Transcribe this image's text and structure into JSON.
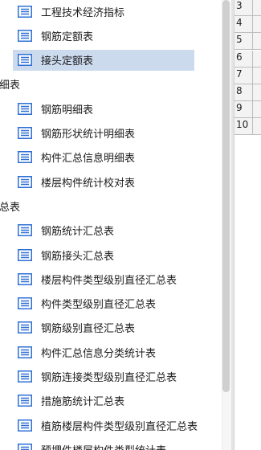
{
  "tree": {
    "items": [
      {
        "type": "item",
        "label": "工程技术经济指标",
        "name": "tree-item-gongcheng-jishu-jingji-zhibiao"
      },
      {
        "type": "item",
        "label": "钢筋定额表",
        "name": "tree-item-gangjin-ding-e-biao"
      },
      {
        "type": "item",
        "label": "接头定额表",
        "name": "tree-item-jietou-ding-e-biao",
        "selected": true
      },
      {
        "type": "group",
        "label": "明细表",
        "name": "tree-group-mingxibiao"
      },
      {
        "type": "item",
        "label": "钢筋明细表",
        "name": "tree-item-gangjin-mingxibiao"
      },
      {
        "type": "item",
        "label": "钢筋形状统计明细表",
        "name": "tree-item-gangjin-xingzhuang-tongji-mingxibiao"
      },
      {
        "type": "item",
        "label": "构件汇总信息明细表",
        "name": "tree-item-goujian-huizong-xinxi-mingxibiao"
      },
      {
        "type": "item",
        "label": "楼层构件统计校对表",
        "name": "tree-item-louceng-goujian-tongji-jiaodui-biao"
      },
      {
        "type": "group",
        "label": "汇总表",
        "name": "tree-group-huizongbiao"
      },
      {
        "type": "item",
        "label": "钢筋统计汇总表",
        "name": "tree-item-gangjin-tongji-huizongbiao"
      },
      {
        "type": "item",
        "label": "钢筋接头汇总表",
        "name": "tree-item-gangjin-jietou-huizongbiao"
      },
      {
        "type": "item",
        "label": "楼层构件类型级别直径汇总表",
        "name": "tree-item-louceng-goujian-leixing-jibie-zhijing-huizongbiao"
      },
      {
        "type": "item",
        "label": "构件类型级别直径汇总表",
        "name": "tree-item-goujian-leixing-jibie-zhijing-huizongbiao"
      },
      {
        "type": "item",
        "label": "钢筋级别直径汇总表",
        "name": "tree-item-gangjin-jibie-zhijing-huizongbiao"
      },
      {
        "type": "item",
        "label": "构件汇总信息分类统计表",
        "name": "tree-item-goujian-huizong-xinxi-fenlei-tongji-biao"
      },
      {
        "type": "item",
        "label": "钢筋连接类型级别直径汇总表",
        "name": "tree-item-gangjin-lianjie-leixing-jibie-zhijing-huizongbiao"
      },
      {
        "type": "item",
        "label": "措施筋统计汇总表",
        "name": "tree-item-cuoshijin-tongji-huizongbiao"
      },
      {
        "type": "item",
        "label": "植筋楼层构件类型级别直径汇总表",
        "name": "tree-item-zhijin-louceng-goujian-leixing-jibie-zhijing-huizongbiao"
      },
      {
        "type": "item",
        "label": "预埋件楼层构件类型统计表",
        "name": "tree-item-yumaijian-louceng-goujian-leixing-tongji-biao"
      }
    ]
  },
  "grid": {
    "row_numbers": [
      "3",
      "4",
      "5",
      "6",
      "7",
      "8",
      "9",
      "10"
    ]
  },
  "colors": {
    "selected_bg": "#ccdaee",
    "icon_blue": "#2f6fd6"
  },
  "icons": {
    "report": "report-list-icon"
  }
}
